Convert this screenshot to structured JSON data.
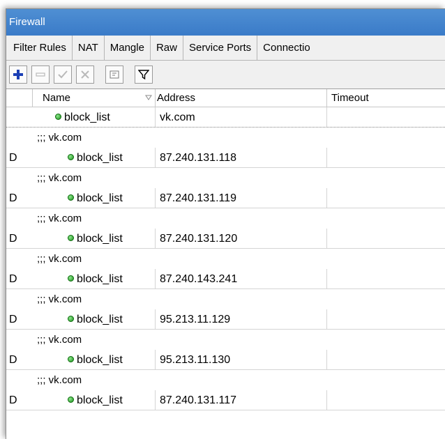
{
  "window": {
    "title": "Firewall"
  },
  "tabs": [
    "Filter Rules",
    "NAT",
    "Mangle",
    "Raw",
    "Service Ports",
    "Connectio"
  ],
  "toolbar": {
    "buttons": [
      {
        "name": "add-button",
        "icon": "plus-icon",
        "enabled": true
      },
      {
        "name": "remove-button",
        "icon": "minus-icon",
        "enabled": false
      },
      {
        "name": "enable-button",
        "icon": "check-icon",
        "enabled": false
      },
      {
        "name": "disable-button",
        "icon": "x-icon",
        "enabled": false
      },
      {
        "name": "comment-button",
        "icon": "note-icon",
        "enabled": true
      },
      {
        "name": "filter-button",
        "icon": "funnel-icon",
        "enabled": true
      }
    ],
    "colors": {
      "add": "#1a3fb5",
      "disabled": "#b9b9b9"
    }
  },
  "table": {
    "columns": [
      "Name",
      "Address",
      "Timeout"
    ],
    "first_row": {
      "flag": "",
      "name": "block_list",
      "address": "vk.com",
      "timeout": ""
    },
    "rows": [
      {
        "comment": ";;; vk.com",
        "flag": "D",
        "name": "block_list",
        "address": "87.240.131.118",
        "timeout": ""
      },
      {
        "comment": ";;; vk.com",
        "flag": "D",
        "name": "block_list",
        "address": "87.240.131.119",
        "timeout": ""
      },
      {
        "comment": ";;; vk.com",
        "flag": "D",
        "name": "block_list",
        "address": "87.240.131.120",
        "timeout": ""
      },
      {
        "comment": ";;; vk.com",
        "flag": "D",
        "name": "block_list",
        "address": "87.240.143.241",
        "timeout": ""
      },
      {
        "comment": ";;; vk.com",
        "flag": "D",
        "name": "block_list",
        "address": "95.213.11.129",
        "timeout": ""
      },
      {
        "comment": ";;; vk.com",
        "flag": "D",
        "name": "block_list",
        "address": "95.213.11.130",
        "timeout": ""
      },
      {
        "comment": ";;; vk.com",
        "flag": "D",
        "name": "block_list",
        "address": "87.240.131.117",
        "timeout": ""
      }
    ]
  },
  "colors": {
    "titlebar": "#3a7bc8",
    "status_dot": "#1a8f1a"
  }
}
